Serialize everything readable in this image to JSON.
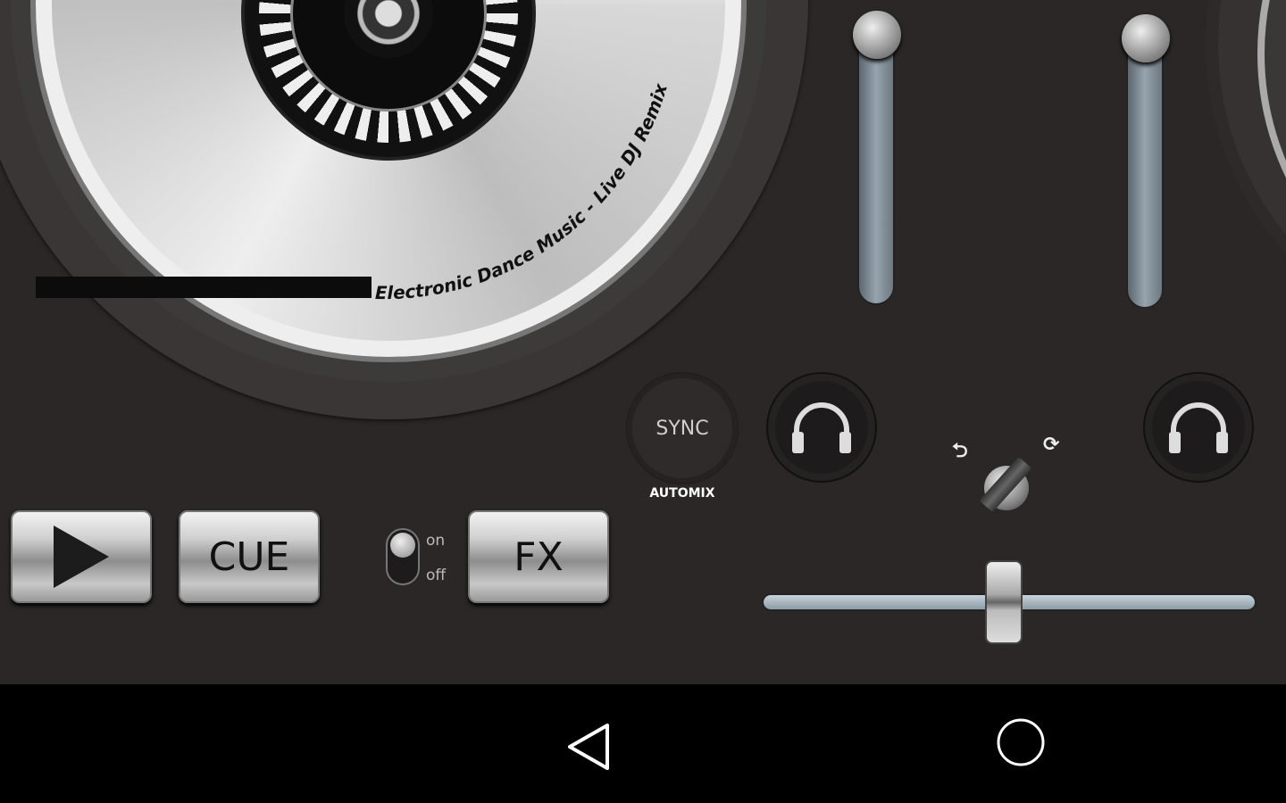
{
  "deck": {
    "record_label_text": "Electronic Dance Music - Live DJ Remix",
    "play_icon": "play-icon",
    "cue_label": "CUE",
    "fx_label": "FX",
    "fx_toggle": {
      "on_label": "on",
      "off_label": "off",
      "state": "off"
    }
  },
  "mixer": {
    "sync_label": "SYNC",
    "automix_label": "AUTOMIX",
    "left_volume": 0.97,
    "right_volume": 0.96,
    "crossfader": 0.49,
    "loop_left_icon": "loop-left-icon",
    "loop_right_icon": "loop-right-icon"
  },
  "navbar": {
    "back_icon": "back-triangle-icon",
    "home_icon": "home-circle-icon"
  }
}
